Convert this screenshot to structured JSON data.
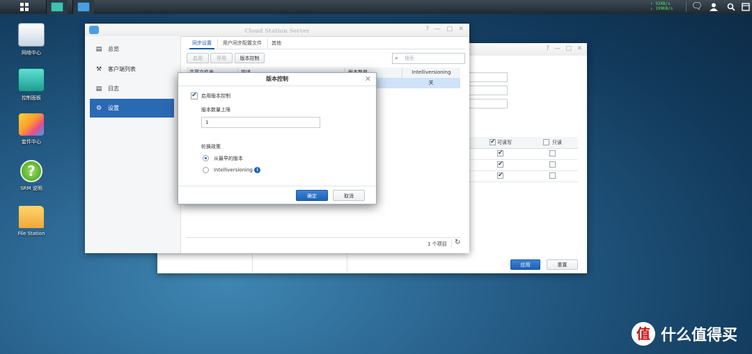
{
  "taskbar": {
    "net_up": "↑ 92KB/s",
    "net_down": "↓ 199KB/s",
    "icons": [
      "main-menu-icon",
      "control-panel-icon",
      "cloud-station-icon",
      "chat-icon",
      "user-icon",
      "search-icon",
      "widgets-icon"
    ]
  },
  "desktop": {
    "icons": [
      {
        "label": "网络中心",
        "icon": "router-icon"
      },
      {
        "label": "控制面板",
        "icon": "control-panel-icon"
      },
      {
        "label": "套件中心",
        "icon": "package-icon"
      },
      {
        "label": "SRM 说明",
        "icon": "help-icon",
        "glyph": "?"
      },
      {
        "label": "File Station",
        "icon": "folder-icon"
      }
    ]
  },
  "main_window": {
    "title": "Cloud Station Server",
    "sidebar": [
      {
        "label": "总览",
        "icon": "overview-icon"
      },
      {
        "label": "客户端列表",
        "icon": "wrench-icon"
      },
      {
        "label": "日志",
        "icon": "log-icon"
      },
      {
        "label": "设置",
        "icon": "gear-icon"
      }
    ],
    "tabs": [
      "同步设置",
      "用户同步配置文件",
      "其他"
    ],
    "toolbar": {
      "apply": "启用",
      "disable": "停用",
      "version_control": "版本控制"
    },
    "search_placeholder": "搜索",
    "grid": {
      "headers": [
        "共享文件夹",
        "描述",
        "版本数量",
        "Intelliversioning"
      ],
      "visible_header_3": "版本数量",
      "row": {
        "intelliversioning": "关"
      }
    },
    "footer": {
      "count": "1 个项目"
    }
  },
  "back_window": {
    "grid_headers": {
      "rw": "可读写",
      "ro": "只读"
    },
    "rows": [
      {
        "rw": true,
        "ro": false
      },
      {
        "rw": true,
        "ro": false
      },
      {
        "rw": true,
        "ro": false
      }
    ],
    "apply": "应用",
    "reset": "重置"
  },
  "modal": {
    "title": "版本控制",
    "enable_label": "启用版本控制",
    "enable_checked": true,
    "max_versions_label": "版本数量上限",
    "max_versions_value": "1",
    "rotation_label": "轮换政策",
    "option_earliest": "从最早的版本",
    "option_intelli": "Intelliversioning",
    "selected": "earliest",
    "ok": "确定",
    "cancel": "取消"
  },
  "watermark": {
    "logo_glyph": "值",
    "text": "什么值得买"
  },
  "colors": {
    "accent": "#2a6ab3",
    "selected_row": "#cfe2f7",
    "net_text": "#4fe36b"
  }
}
